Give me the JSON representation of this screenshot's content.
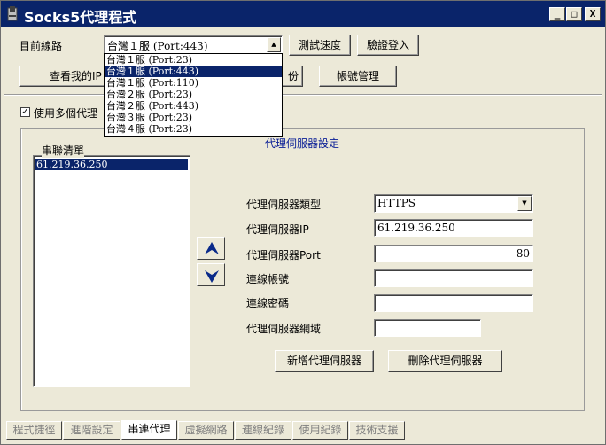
{
  "window": {
    "title": "Socks5代理程式",
    "min_glyph": "_",
    "max_glyph": "□",
    "close_glyph": "X"
  },
  "top": {
    "route_label": "目前線路",
    "route_value": "台灣１服 (Port:443)",
    "test_speed": "測試速度",
    "verify_login": "驗證登入",
    "view_ip": "查看我的IP",
    "hidden_button_suffix": "份",
    "account_mgmt": "帳號管理"
  },
  "dropdown": {
    "options": [
      "台灣１服 (Port:23)",
      "台灣１服 (Port:443)",
      "台灣１服 (Port:110)",
      "台灣２服 (Port:23)",
      "台灣２服 (Port:443)",
      "台灣３服 (Port:23)",
      "台灣４服 (Port:23)"
    ],
    "selected_index": 1
  },
  "multi_proxy": {
    "label": "使用多個代理",
    "checked": true
  },
  "chain": {
    "title": "串聯清單",
    "items": [
      "61.219.36.250"
    ]
  },
  "proxy": {
    "section_title": "代理伺服器設定",
    "type_label": "代理伺服器類型",
    "type_value": "HTTPS",
    "ip_label": "代理伺服器IP",
    "ip_value": "61.219.36.250",
    "port_label": "代理伺服器Port",
    "port_value": "80",
    "user_label": "連線帳號",
    "user_value": "",
    "pass_label": "連線密碼",
    "pass_value": "",
    "domain_label": "代理伺服器網域",
    "domain_value": "",
    "add_button": "新增代理伺服器",
    "delete_button": "刪除代理伺服器"
  },
  "tabs": [
    {
      "label": "程式捷徑",
      "active": false
    },
    {
      "label": "進階設定",
      "active": false
    },
    {
      "label": "串連代理",
      "active": true
    },
    {
      "label": "虛擬網路",
      "active": false
    },
    {
      "label": "連線紀錄",
      "active": false
    },
    {
      "label": "使用紀錄",
      "active": false
    },
    {
      "label": "技術支援",
      "active": false
    }
  ],
  "colors": {
    "title_bar": "#0a246a",
    "selection": "#0a246a",
    "section_title": "#0a1e96",
    "arrow_icon": "#0a2a8a"
  }
}
